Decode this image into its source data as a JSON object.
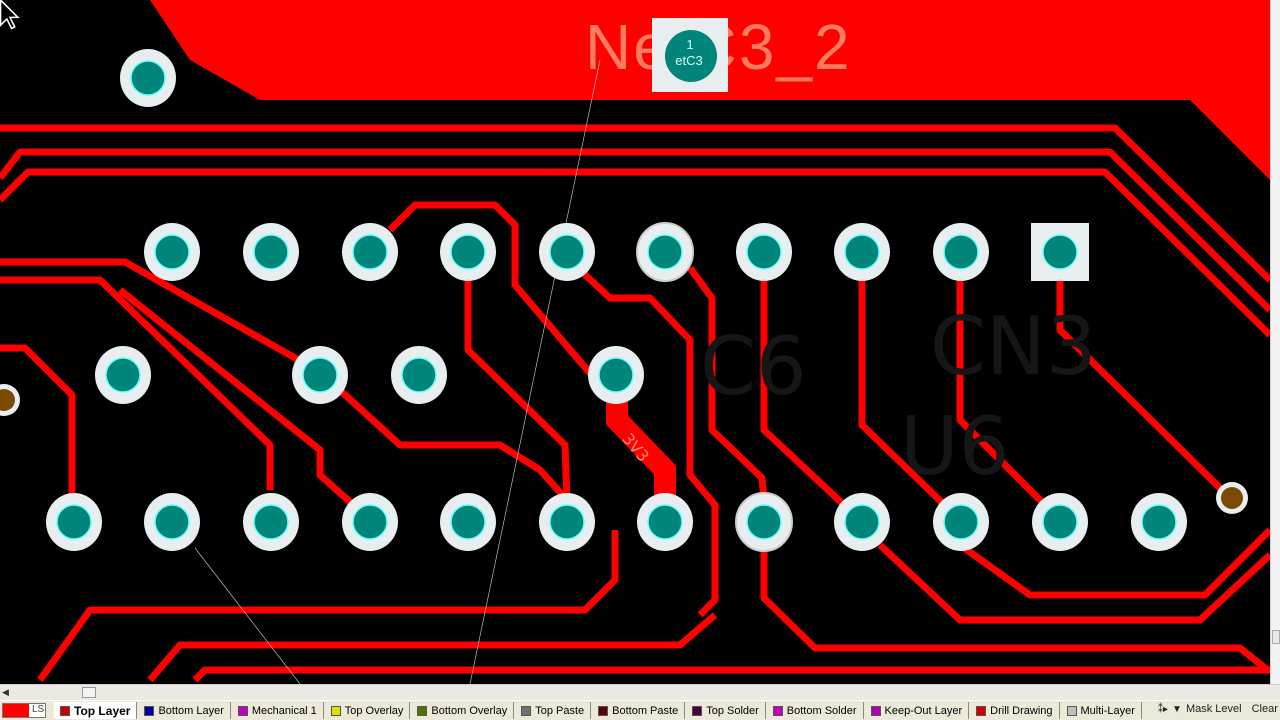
{
  "canvas": {
    "net_label": "NetC3_2",
    "pad_label_number": "1",
    "pad_label_net": "etC3",
    "trace_label": "3V3",
    "faint_designators": [
      "C6",
      "CN3",
      "U6"
    ],
    "colors": {
      "background": "#000000",
      "top_layer": "#ff0000",
      "pad_ring": "#e8eef0",
      "pad_hole": "#00857a",
      "via_hole": "#7a4a00"
    }
  },
  "layer_bar": {
    "ls_label": "LS",
    "tabs": [
      {
        "label": "Top Layer",
        "color": "#cc0000",
        "active": true
      },
      {
        "label": "Bottom Layer",
        "color": "#0000a0",
        "active": false
      },
      {
        "label": "Mechanical 1",
        "color": "#c000c0",
        "active": false
      },
      {
        "label": "Top Overlay",
        "color": "#e0e000",
        "active": false
      },
      {
        "label": "Bottom Overlay",
        "color": "#507000",
        "active": false
      },
      {
        "label": "Top Paste",
        "color": "#707070",
        "active": false
      },
      {
        "label": "Bottom Paste",
        "color": "#600000",
        "active": false
      },
      {
        "label": "Top Solder",
        "color": "#400040",
        "active": false
      },
      {
        "label": "Bottom Solder",
        "color": "#c000c0",
        "active": false
      },
      {
        "label": "Keep-Out Layer",
        "color": "#b000b0",
        "active": false
      },
      {
        "label": "Drill Drawing",
        "color": "#d00000",
        "active": false
      },
      {
        "label": "Multi-Layer",
        "color": "#c0c0c0",
        "active": false
      }
    ],
    "tools": {
      "snap_icon": "snap-icon",
      "filter_icon": "filter-icon",
      "mask_level": "Mask Level",
      "clear": "Clear"
    }
  }
}
